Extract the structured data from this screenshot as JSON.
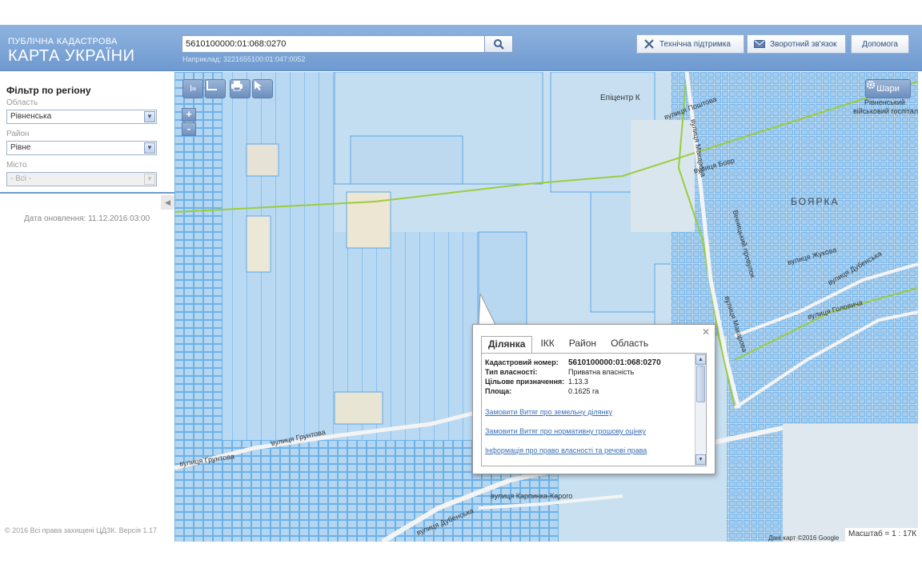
{
  "header": {
    "brand_small": "ПУБЛІЧНА КАДАСТРОВА",
    "brand_big": "КАРТА УКРАЇНИ",
    "search_value": "5610100000:01:068:0270",
    "search_hint": "Наприклад: 3221655100:01:047:0052",
    "buttons": {
      "support": "Технічна підтримка",
      "feedback": "Зворотний зв'язок",
      "help": "Допомога"
    }
  },
  "sidebar": {
    "title": "Фільтр по регіону",
    "region_label": "Область",
    "region_value": "Рівненська",
    "district_label": "Район",
    "district_value": "Рівне",
    "city_label": "Місто",
    "city_value": "- Всі -",
    "update_date": "Дата оновлення: 11.12.2016 03:00",
    "copyright": "© 2016 Всі права захищені ЦДЗК. Версія 1.17"
  },
  "map": {
    "layers_label": "Шари",
    "labels": {
      "epicentr": "Епіцентр К",
      "boyarka": "БОЯРКА",
      "hospital_1": "Рівненський",
      "hospital_2": "військовий госпітал",
      "street_hrunt": "вулиця Грунтова",
      "street_hrunt2": "вулиця Грунтова",
      "street_karpinka": "вулиця Карпинка-Карого",
      "street_dubenska": "вулиця Дубенська",
      "street_makarova": "вулиця Макарова",
      "street_makarova2": "вулиця Макарова",
      "street_bov": "вулиця Бовр",
      "street_posh": "вулиця Поштова",
      "street_zhuk": "вулиця Жукова",
      "street_holov": "вулиця Головича",
      "street_dubenska2": "вулиця Дубенська",
      "street_vinn": "Вінницький провулок"
    },
    "attribution": "Дані карт ©2016 Google",
    "scale": "Масштаб = 1 : 17К"
  },
  "popup": {
    "tabs": [
      "Ділянка",
      "ІКК",
      "Район",
      "Область"
    ],
    "fields": [
      {
        "k": "Кадастровий номер:",
        "v": "5610100000:01:068:0270"
      },
      {
        "k": "Тип власності:",
        "v": "Приватна власність"
      },
      {
        "k": "Цільове призначення:",
        "v": "1.13.3"
      },
      {
        "k": "Площа:",
        "v": "0.1625 га"
      }
    ],
    "links": [
      "Замовити Витяг про земельну ділянку",
      "Замовити Витяг про нормативну грошову оцінку",
      "Інформація про право власності та речові права"
    ]
  },
  "colors": {
    "header": "#7ea6d6",
    "parcel_fill": "#a9cff0",
    "parcel_stroke": "#5aa9e8",
    "boundary": "#9ccc3c",
    "link": "#3a6fb4"
  }
}
